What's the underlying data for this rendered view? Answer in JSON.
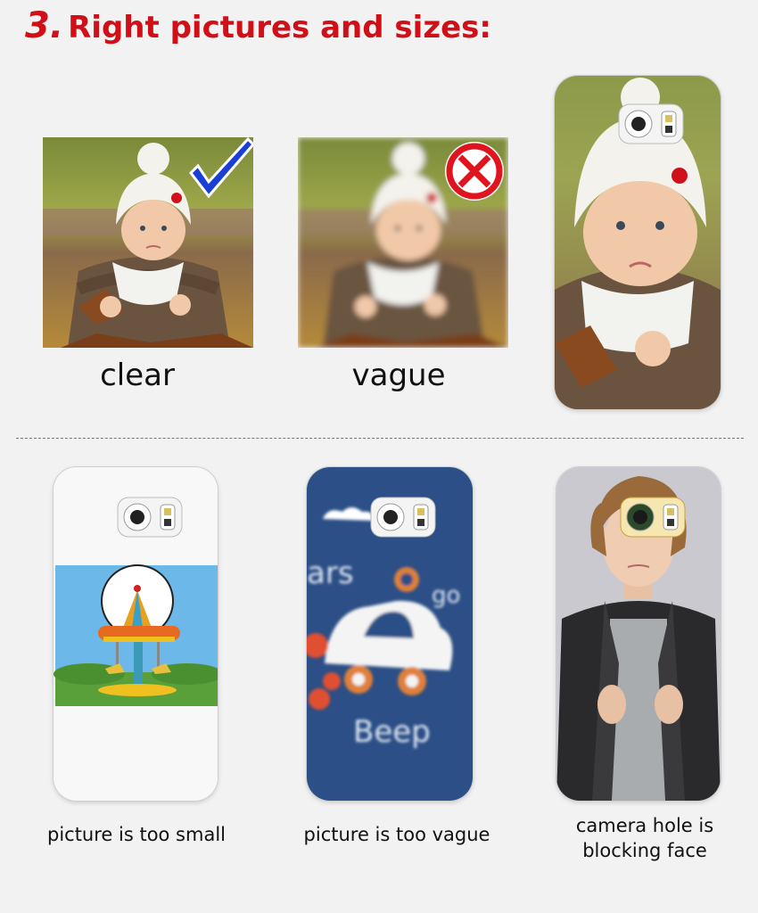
{
  "heading": {
    "number": "3.",
    "text": "Right pictures and sizes:"
  },
  "top_row": {
    "clear_label": "clear",
    "vague_label": "vague"
  },
  "bottom_row": {
    "small_label": "picture is too small",
    "vague_label": "picture is too vague",
    "hole_label_line1": "camera hole is",
    "hole_label_line2": "blocking face"
  },
  "art": {
    "car_text_1": "ars",
    "car_text_2": "go",
    "car_text_3": "Beep"
  },
  "colors": {
    "heading_red": "#d01018",
    "check_blue": "#1a3fd6",
    "cross_red": "#e0141e",
    "phone_blue": "#2b4f86"
  }
}
